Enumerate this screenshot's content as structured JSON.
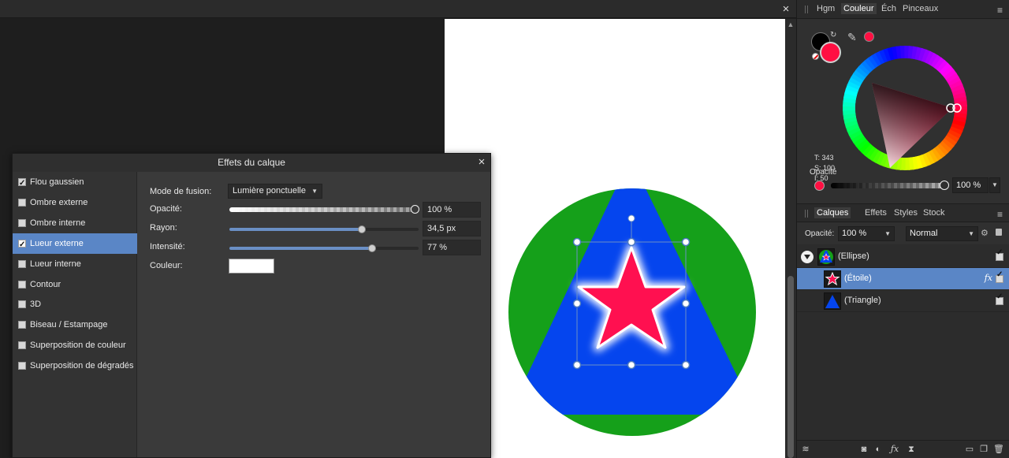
{
  "document": {
    "close_glyph": "×"
  },
  "dialog": {
    "title": "Effets du calque",
    "close_glyph": "×",
    "effects": [
      {
        "label": "Flou gaussien",
        "checked": true,
        "selected": false
      },
      {
        "label": "Ombre externe",
        "checked": false,
        "selected": false
      },
      {
        "label": "Ombre interne",
        "checked": false,
        "selected": false
      },
      {
        "label": "Lueur externe",
        "checked": true,
        "selected": true
      },
      {
        "label": "Lueur interne",
        "checked": false,
        "selected": false
      },
      {
        "label": "Contour",
        "checked": false,
        "selected": false
      },
      {
        "label": "3D",
        "checked": false,
        "selected": false
      },
      {
        "label": "Biseau / Estampage",
        "checked": false,
        "selected": false
      },
      {
        "label": "Superposition de couleur",
        "checked": false,
        "selected": false
      },
      {
        "label": "Superposition de dégradés",
        "checked": false,
        "selected": false
      }
    ],
    "blend_label": "Mode de fusion:",
    "blend_value": "Lumière ponctuelle",
    "opacity_label": "Opacité:",
    "opacity_value": "100 %",
    "opacity_level": 1.0,
    "radius_label": "Rayon:",
    "radius_value": "34,5 px",
    "radius_level": 0.7,
    "intensity_label": "Intensité:",
    "intensity_value": "77 %",
    "intensity_level": 0.77,
    "color_label": "Couleur:",
    "glow_color": "#ffffff"
  },
  "color_panel": {
    "tabs": [
      "Hgm",
      "Couleur",
      "Éch",
      "Pinceaux"
    ],
    "active_tab": "Couleur",
    "fill_color": "#ff0f42",
    "stroke_color": "#000000",
    "t_text": "T: 343",
    "s_text": "S: 100",
    "i_text": "I: 50",
    "opacity_label": "Opacité",
    "opacity_value": "100 %",
    "opacity_level": 1.0
  },
  "layers_panel": {
    "tabs": [
      "Calques",
      "Effets",
      "Styles",
      "Stock"
    ],
    "active_tab": "Calques",
    "opacity_label": "Opacité:",
    "opacity_value": "100 %",
    "blend_mode": "Normal",
    "layers": [
      {
        "name": "(Ellipse)",
        "selected": false,
        "visible": true,
        "fx": false
      },
      {
        "name": "(Étoile)",
        "selected": true,
        "visible": true,
        "fx": true
      },
      {
        "name": "(Triangle)",
        "selected": false,
        "visible": true,
        "fx": false
      }
    ],
    "fx_text": "fx"
  },
  "artwork": {
    "circle_color": "#15a01a",
    "triangle_color": "#0545ee",
    "star_color": "#ff1050",
    "glow_color": "#ffffff"
  }
}
